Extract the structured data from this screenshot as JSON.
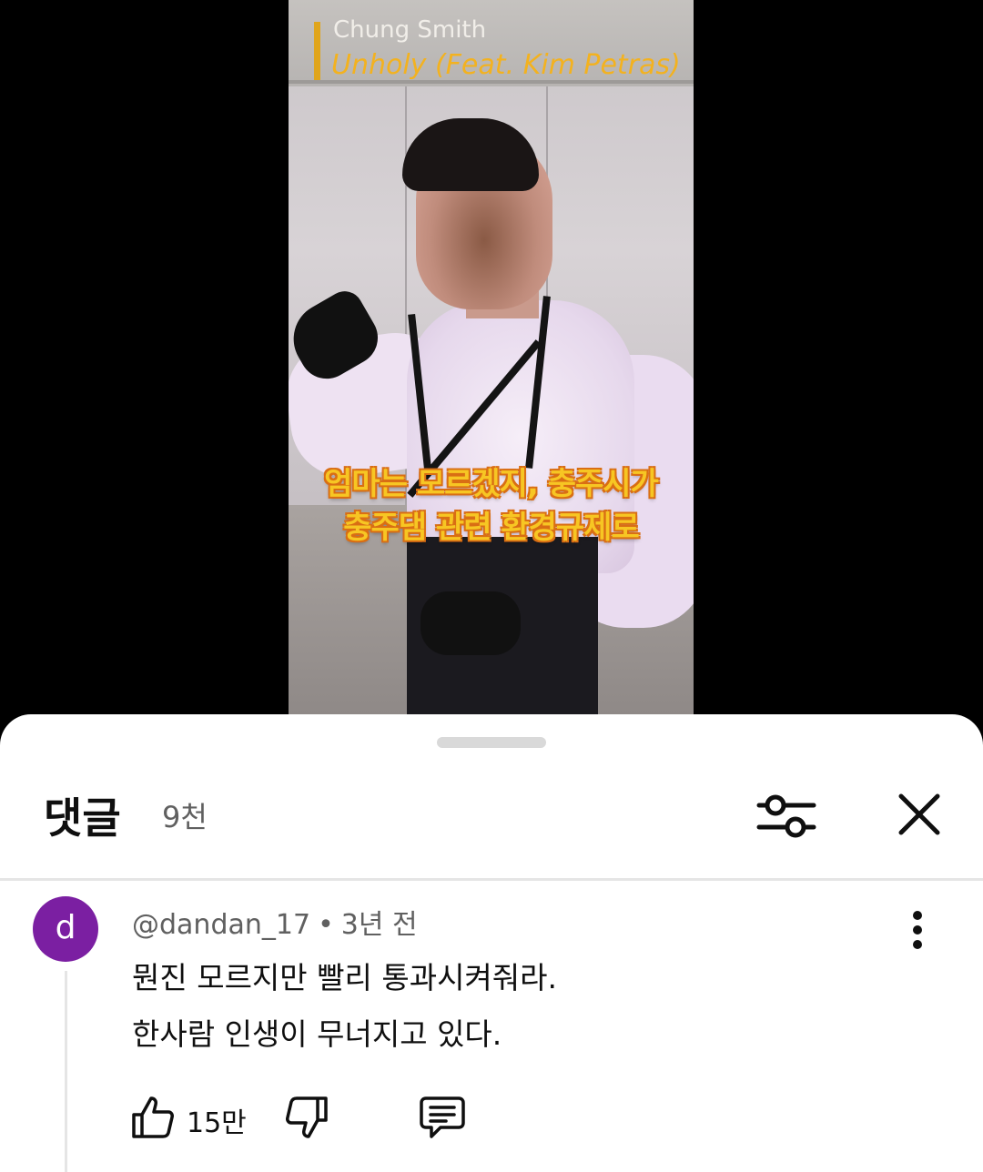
{
  "video": {
    "artist": "Chung Smith",
    "song_title": "Unholy (Feat. Kim Petras)",
    "caption_line1": "엄마는 모르겠지, 충주시가",
    "caption_line2": "충주댐 관련 환경규제로"
  },
  "comments_panel": {
    "title": "댓글",
    "count": "9천",
    "filter_icon": "sort-filter-icon",
    "close_icon": "close-icon"
  },
  "comment": {
    "avatar_letter": "d",
    "avatar_color": "#7b1fa2",
    "author": "@dandan_17",
    "separator": "•",
    "time": "3년 전",
    "text_line1": "뭔진 모르지만 빨리 통과시켜줘라.",
    "text_line2": "한사람 인생이 무너지고 있다.",
    "like_count": "15만",
    "more_icon": "more-vert-icon",
    "like_icon": "thumb-up-icon",
    "dislike_icon": "thumb-down-icon",
    "reply_icon": "reply-icon"
  }
}
